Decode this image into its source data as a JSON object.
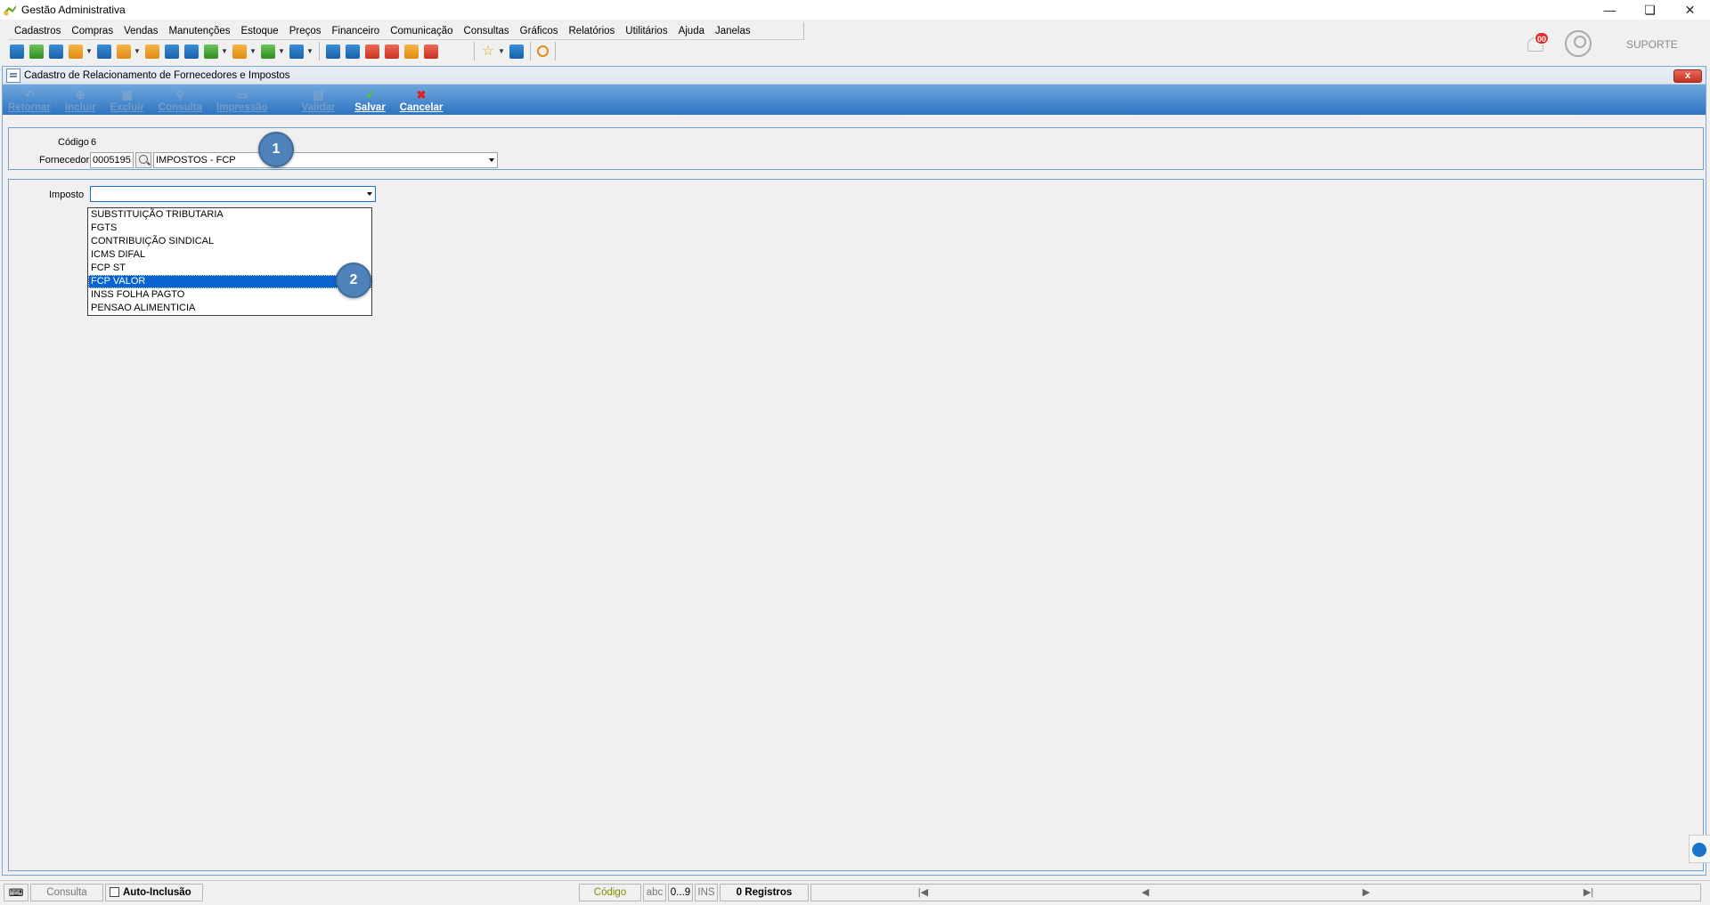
{
  "window": {
    "title": "Gestão Administrativa"
  },
  "menu": [
    "Cadastros",
    "Compras",
    "Vendas",
    "Manutenções",
    "Estoque",
    "Preços",
    "Financeiro",
    "Comunicação",
    "Consultas",
    "Gráficos",
    "Relatórios",
    "Utilitários",
    "Ajuda",
    "Janelas"
  ],
  "notifications": {
    "count": "00"
  },
  "user": {
    "name": "SUPORTE"
  },
  "form": {
    "title": "Cadastro de Relacionamento de Fornecedores e Impostos",
    "close": "x",
    "actions": [
      {
        "label": "Retornar",
        "enabled": false,
        "icon": "return-icon"
      },
      {
        "label": "Incluir",
        "enabled": false,
        "icon": "add-icon"
      },
      {
        "label": "Excluir",
        "enabled": false,
        "icon": "trash-icon"
      },
      {
        "label": "Consulta",
        "enabled": false,
        "icon": "search-icon"
      },
      {
        "label": "Impressão",
        "enabled": false,
        "icon": "print-icon"
      },
      {
        "label": "Validar",
        "enabled": false,
        "icon": "validate-icon"
      },
      {
        "label": "Salvar",
        "enabled": true,
        "icon": "check-icon"
      },
      {
        "label": "Cancelar",
        "enabled": true,
        "icon": "x-icon"
      }
    ],
    "codigo_label": "Código",
    "codigo_value": "6",
    "fornecedor_label": "Fornecedor",
    "fornecedor_code": "0005195",
    "fornecedor_name": "IMPOSTOS - FCP",
    "imposto_label": "Imposto",
    "imposto_value": "",
    "imposto_options": [
      "SUBSTITUIÇÃO TRIBUTARIA",
      "FGTS",
      "CONTRIBUIÇÃO SINDICAL",
      "ICMS DIFAL",
      "FCP ST",
      "FCP VALOR",
      "INSS FOLHA PAGTO",
      "PENSAO ALIMENTICIA"
    ],
    "imposto_selected": "FCP VALOR"
  },
  "callouts": [
    "1",
    "2"
  ],
  "status": {
    "mode": "Consulta",
    "auto_inclusao": "Auto-Inclusão",
    "field": "Código",
    "abc": "abc",
    "num": "0...9",
    "ins": "INS",
    "registros": "0 Registros"
  },
  "colors": {
    "accent": "#2e74c2",
    "selection": "#0a64d0",
    "callout": "#4f82b8"
  }
}
